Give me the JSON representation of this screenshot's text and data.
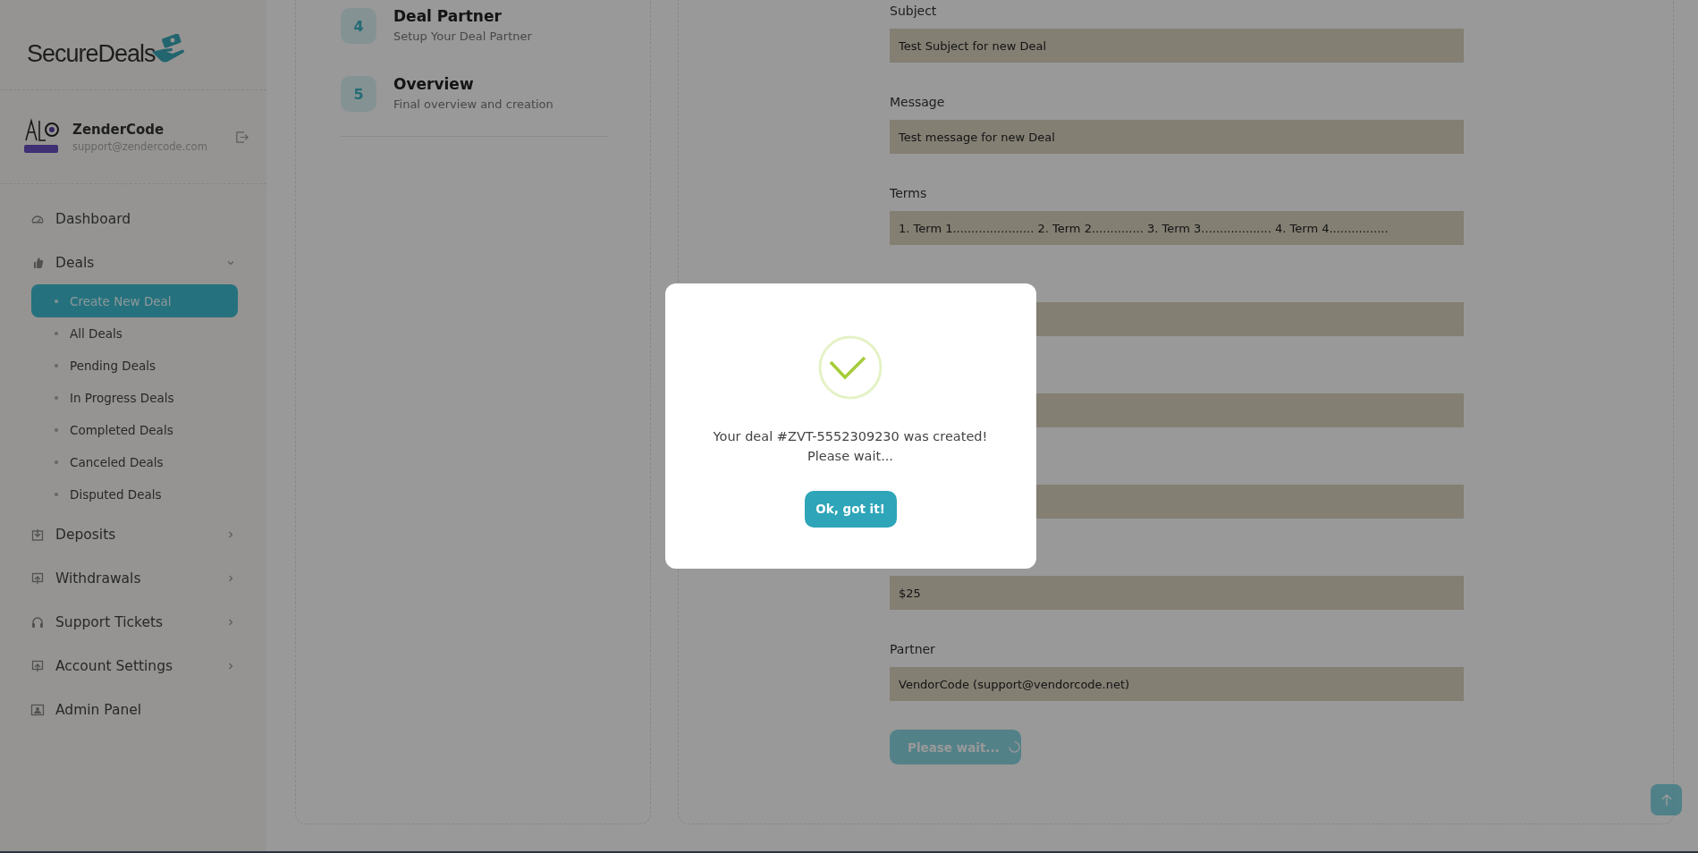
{
  "brand": {
    "name": "SecureDeals"
  },
  "user": {
    "name": "ZenderCode",
    "email": "support@zendercode.com"
  },
  "nav": [
    {
      "label": "Dashboard",
      "kind": "link"
    },
    {
      "label": "Deals",
      "kind": "group",
      "expanded": true,
      "children": [
        {
          "label": "Create New Deal",
          "selected": true
        },
        {
          "label": "All Deals",
          "selected": false
        },
        {
          "label": "Pending Deals",
          "selected": false
        },
        {
          "label": "In Progress Deals",
          "selected": false
        },
        {
          "label": "Completed Deals",
          "selected": false
        },
        {
          "label": "Canceled Deals",
          "selected": false
        },
        {
          "label": "Disputed Deals",
          "selected": false
        }
      ]
    },
    {
      "label": "Deposits",
      "kind": "group",
      "expanded": false
    },
    {
      "label": "Withdrawals",
      "kind": "group",
      "expanded": false
    },
    {
      "label": "Support Tickets",
      "kind": "group",
      "expanded": false
    },
    {
      "label": "Account Settings",
      "kind": "group",
      "expanded": false
    },
    {
      "label": "Admin Panel",
      "kind": "link"
    }
  ],
  "steps": [
    {
      "number": "4",
      "title": "Deal Partner",
      "subtitle": "Setup Your Deal Partner"
    },
    {
      "number": "5",
      "title": "Overview",
      "subtitle": "Final overview and creation"
    }
  ],
  "form": {
    "fields": [
      {
        "kind": "input",
        "label": "Subject",
        "value": "Test Subject for new Deal"
      },
      {
        "kind": "input",
        "label": "Message",
        "value": "Test message for new Deal"
      },
      {
        "kind": "input",
        "label": "Terms",
        "value": "1. Term 1...................... 2. Term 2.............. 3. Term 3................... 4. Term 4................"
      },
      {
        "kind": "input"
      },
      {
        "kind": "input"
      },
      {
        "kind": "input"
      },
      {
        "kind": "input",
        "value": "$25"
      },
      {
        "kind": "input",
        "label": "Partner",
        "value": "VendorCode (support@vendorcode.net)"
      }
    ],
    "submit": {
      "label": "Please wait...",
      "loading": true,
      "disabled": true
    }
  },
  "modal": {
    "message": "Your deal #ZVT-5552309230 was created!",
    "note": "Please wait...",
    "button": "Ok, got it!"
  }
}
